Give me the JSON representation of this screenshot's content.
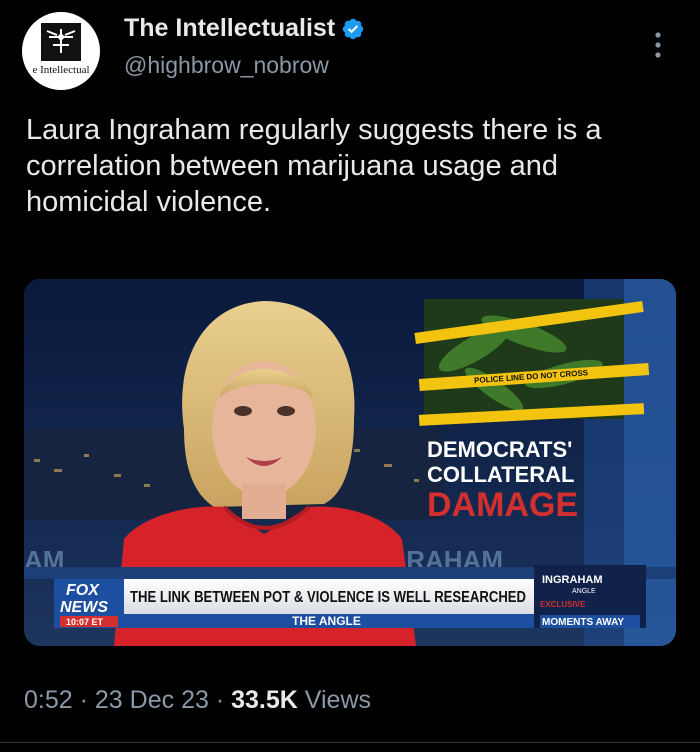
{
  "account": {
    "display_name": "The Intellectualist",
    "handle": "@highbrow_nobrow",
    "avatar_text": "e Intellectual",
    "verified": true
  },
  "tweet": {
    "text": "Laura Ingraham regularly suggests there is a correlation between marijuana usage and homicidal violence."
  },
  "media": {
    "graphic_line1": "DEMOCRATS'",
    "graphic_line2": "COLLATERAL",
    "graphic_line3": "DAMAGE",
    "tape_text": "POLICE LINE DO NOT CROSS",
    "bg_word": "GRAHAM",
    "bg_word_left": "AM",
    "fox_line1": "FOX",
    "fox_line2": "NEWS",
    "time": "10:07 ET",
    "chyron_headline": "THE LINK BETWEEN POT & VIOLENCE IS WELL RESEARCHED",
    "chyron_sub": "THE ANGLE",
    "promo_show": "INGRAHAM",
    "promo_show_sub": "ANGLE",
    "promo_exclusive": "EXCLUSIVE",
    "promo_moments": "MOMENTS AWAY"
  },
  "meta": {
    "time": "0:52",
    "separator": "·",
    "date": "23 Dec 23",
    "views_count": "33.5K",
    "views_label": "Views"
  },
  "colors": {
    "background": "#000000",
    "text": "#e7e9ea",
    "secondary": "#8b98a5",
    "verified": "#1d9bf0",
    "fox_red": "#d32f2f"
  }
}
